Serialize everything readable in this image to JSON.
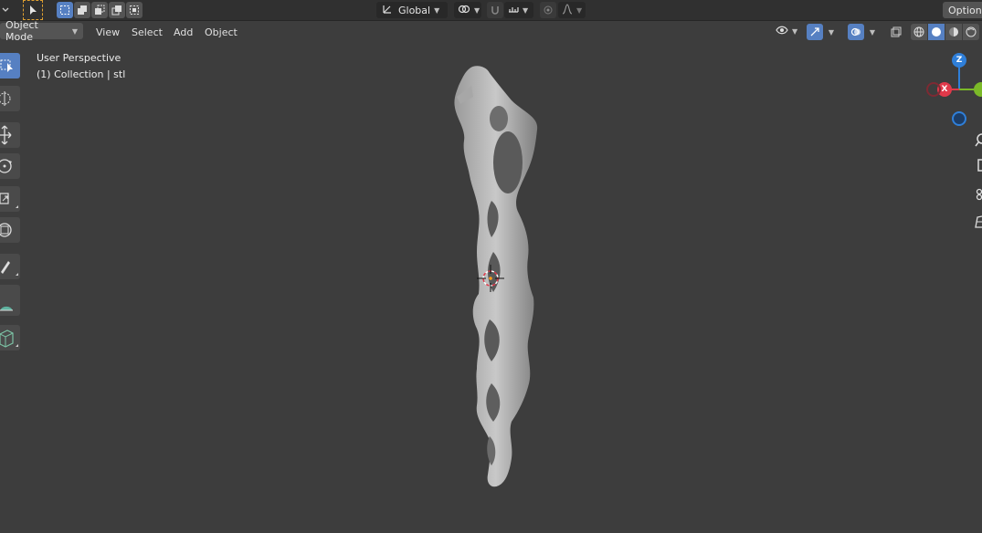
{
  "topbar": {
    "orientation": "Global",
    "options": "Options"
  },
  "header": {
    "mode": "Object Mode",
    "menus": [
      "View",
      "Select",
      "Add",
      "Object"
    ]
  },
  "viewport": {
    "perspective": "User Perspective",
    "collection": "(1) Collection | stl"
  },
  "gizmo": {
    "z": "Z",
    "x": "X"
  },
  "colors": {
    "accent": "#5680c2",
    "x_axis": "#e0394a",
    "y_axis": "#7bb928",
    "z_axis": "#2f7fd9",
    "cursor": "#e0394a"
  }
}
